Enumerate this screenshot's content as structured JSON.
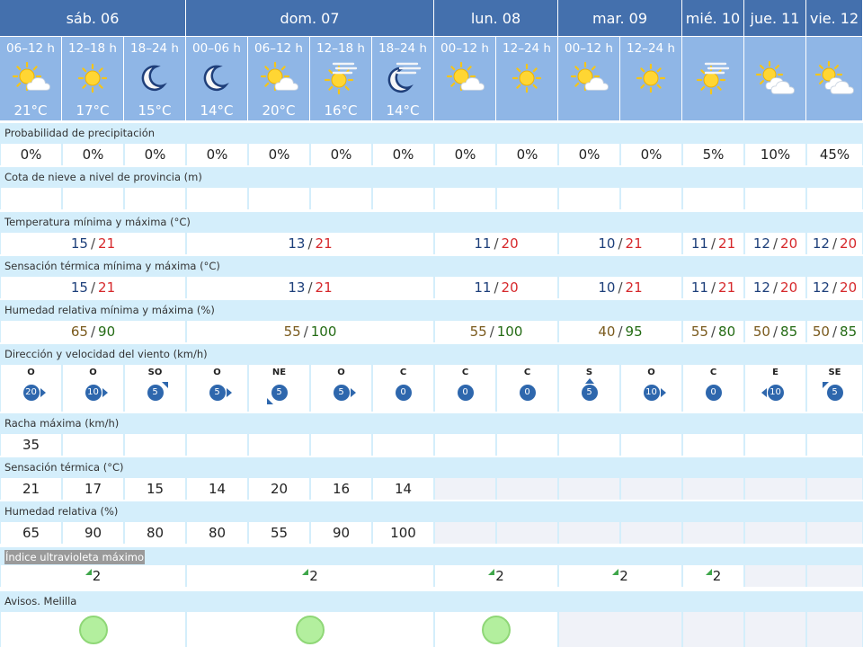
{
  "days": [
    "sáb. 06",
    "dom. 07",
    "lun. 08",
    "mar. 09",
    "mié. 10",
    "jue. 11",
    "vie. 12"
  ],
  "periods": [
    {
      "label": "06–12 h",
      "icon": "sun-cloud-icon",
      "temp": "21°C"
    },
    {
      "label": "12–18 h",
      "icon": "sun-icon",
      "temp": "17°C"
    },
    {
      "label": "18–24 h",
      "icon": "moon-icon",
      "temp": "15°C"
    },
    {
      "label": "00–06 h",
      "icon": "moon-icon",
      "temp": "14°C"
    },
    {
      "label": "06–12 h",
      "icon": "sun-cloud-icon",
      "temp": "20°C"
    },
    {
      "label": "12–18 h",
      "icon": "sun-haze-icon",
      "temp": "16°C"
    },
    {
      "label": "18–24 h",
      "icon": "moon-haze-icon",
      "temp": "14°C"
    },
    {
      "label": "00–12 h",
      "icon": "sun-cloud-icon",
      "temp": ""
    },
    {
      "label": "12–24 h",
      "icon": "sun-icon",
      "temp": ""
    },
    {
      "label": "00–12 h",
      "icon": "sun-cloud-icon",
      "temp": ""
    },
    {
      "label": "12–24 h",
      "icon": "sun-icon",
      "temp": ""
    },
    {
      "label": "",
      "icon": "sun-haze-icon",
      "temp": ""
    },
    {
      "label": "",
      "icon": "sun-clouds-icon",
      "temp": ""
    },
    {
      "label": "",
      "icon": "sun-clouds-icon",
      "temp": ""
    }
  ],
  "sections": {
    "precip": "Probabilidad de precipitación",
    "snow": "Cota de nieve a nivel de provincia (m)",
    "temp": "Temperatura mínima y máxima (°C)",
    "feels": "Sensación térmica mínima y máxima (°C)",
    "humidity": "Humedad relativa mínima y máxima (%)",
    "wind": "Dirección y velocidad del viento (km/h)",
    "gust": "Racha máxima (km/h)",
    "feels_now": "Sensación térmica (°C)",
    "rel_humidity": "Humedad relativa (%)",
    "uv": "Índice ultravioleta máximo",
    "warnings": "Avisos. Melilla"
  },
  "precip": [
    "0%",
    "0%",
    "0%",
    "0%",
    "0%",
    "0%",
    "0%",
    "0%",
    "0%",
    "0%",
    "0%",
    "5%",
    "10%",
    "45%"
  ],
  "temp_minmax": [
    {
      "min": "15",
      "max": "21"
    },
    {
      "min": "13",
      "max": "21"
    },
    {
      "min": "11",
      "max": "20"
    },
    {
      "min": "10",
      "max": "21"
    },
    {
      "min": "11",
      "max": "21"
    },
    {
      "min": "12",
      "max": "20"
    },
    {
      "min": "12",
      "max": "20"
    }
  ],
  "feels_minmax": [
    {
      "min": "15",
      "max": "21"
    },
    {
      "min": "13",
      "max": "21"
    },
    {
      "min": "11",
      "max": "20"
    },
    {
      "min": "10",
      "max": "21"
    },
    {
      "min": "11",
      "max": "21"
    },
    {
      "min": "12",
      "max": "20"
    },
    {
      "min": "12",
      "max": "20"
    }
  ],
  "humidity_minmax": [
    {
      "min": "65",
      "max": "90"
    },
    {
      "min": "55",
      "max": "100"
    },
    {
      "min": "55",
      "max": "100"
    },
    {
      "min": "40",
      "max": "95"
    },
    {
      "min": "55",
      "max": "80"
    },
    {
      "min": "50",
      "max": "85"
    },
    {
      "min": "50",
      "max": "85"
    }
  ],
  "wind": [
    {
      "dir": "O",
      "speed": "20",
      "arrow": "e"
    },
    {
      "dir": "O",
      "speed": "10",
      "arrow": "e"
    },
    {
      "dir": "SO",
      "speed": "5",
      "arrow": "ne"
    },
    {
      "dir": "O",
      "speed": "5",
      "arrow": "e"
    },
    {
      "dir": "NE",
      "speed": "5",
      "arrow": "sw"
    },
    {
      "dir": "O",
      "speed": "5",
      "arrow": "e"
    },
    {
      "dir": "C",
      "speed": "0",
      "arrow": ""
    },
    {
      "dir": "C",
      "speed": "0",
      "arrow": ""
    },
    {
      "dir": "C",
      "speed": "0",
      "arrow": ""
    },
    {
      "dir": "S",
      "speed": "5",
      "arrow": "n"
    },
    {
      "dir": "O",
      "speed": "10",
      "arrow": "e"
    },
    {
      "dir": "C",
      "speed": "0",
      "arrow": ""
    },
    {
      "dir": "E",
      "speed": "10",
      "arrow": "w"
    },
    {
      "dir": "SE",
      "speed": "5",
      "arrow": "nw"
    }
  ],
  "gust": [
    "35",
    "",
    "",
    "",
    "",
    "",
    "",
    "",
    "",
    "",
    "",
    "",
    "",
    ""
  ],
  "feels_now": [
    "21",
    "17",
    "15",
    "14",
    "20",
    "16",
    "14"
  ],
  "rel_humidity": [
    "65",
    "90",
    "80",
    "80",
    "55",
    "90",
    "100"
  ],
  "uv": [
    "2",
    "2",
    "2",
    "2",
    "2"
  ],
  "colors": {
    "header": "#4470ad",
    "period": "#8fb6e6",
    "band": "#d4eefb",
    "min": "#1d3f7a",
    "max": "#d6282b",
    "warning_green": "#b3ef9e"
  }
}
